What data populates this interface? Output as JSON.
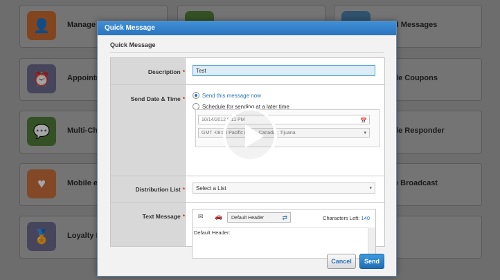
{
  "background_tiles": [
    {
      "label": "Manage C",
      "icon": "contacts-icon",
      "color": "#c96a2d"
    },
    {
      "label": "Appointr",
      "icon": "alarm-clock-icon",
      "color": "#6d6a8e"
    },
    {
      "label": "Multi-Ch",
      "icon": "chat-bubble-icon",
      "color": "#4f7d3a"
    },
    {
      "label": "Mobile e",
      "icon": "heart-message-icon",
      "color": "#c9703b"
    },
    {
      "label": "Loyalty F",
      "icon": "award-ribbon-icon",
      "color": "#6d6a8e"
    },
    {
      "label": "d Messages",
      "icon": "messages-icon",
      "color": "#4a7ea8"
    },
    {
      "label": "ile Coupons",
      "icon": "coupon-icon",
      "color": "#4a7ea8"
    },
    {
      "label": "ile Responder",
      "icon": "responder-icon",
      "color": "#4a7ea8"
    },
    {
      "label": "e Broadcast",
      "icon": "broadcast-icon",
      "color": "#4a7ea8"
    }
  ],
  "modal": {
    "title": "Quick Message",
    "subtitle": "Quick Message",
    "fields": {
      "description": {
        "label": "Description",
        "value": "Test"
      },
      "send_date": {
        "label": "Send Date & Time",
        "option_now": "Send this message now",
        "option_later": "Schedule for sending at a later time",
        "date_value": "10/14/2012 5:11 PM",
        "timezone_value": "GMT -08:00 Pacific (US & Canada); Tijuana"
      },
      "distribution_list": {
        "label": "Distribution List",
        "value": "Select a List"
      },
      "text_message": {
        "label": "Text Message",
        "header_select": "Default Header",
        "chars_left_label": "Characters Left:",
        "chars_left_value": "140",
        "body": "Default Header:"
      }
    },
    "required_mark": "*",
    "cancel_label": "Cancel",
    "send_label": "Send"
  },
  "icons": {
    "calendar": "📅",
    "dropdown": "▾",
    "swap": "⇄",
    "sms": "✉",
    "vcard": "🚗"
  }
}
